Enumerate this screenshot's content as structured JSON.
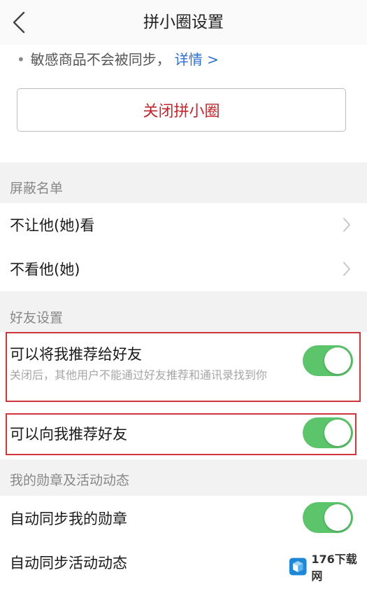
{
  "nav": {
    "title": "拼小圈设置",
    "back_icon": "chevron-left-icon"
  },
  "notice": {
    "bullet": "•",
    "text": "敏感商品不会被同步，",
    "link": "详情 >"
  },
  "close_button": {
    "label": "关闭拼小圈"
  },
  "sections": {
    "block_list": {
      "header": "屏蔽名单",
      "items": [
        {
          "label": "不让他(她)看"
        },
        {
          "label": "不看他(她)"
        }
      ]
    },
    "friend_settings": {
      "header": "好友设置",
      "recommend_me": {
        "label": "可以将我推荐给好友",
        "description": "关闭后，其他用户不能通过好友推荐和通讯录找到你",
        "enabled": true
      },
      "recommend_to_me": {
        "label": "可以向我推荐好友",
        "enabled": true
      }
    },
    "badges": {
      "header": "我的勋章及活动动态",
      "sync_badges": {
        "label": "自动同步我的勋章",
        "enabled": true
      },
      "sync_activity": {
        "label": "自动同步活动动态"
      }
    }
  },
  "watermark": {
    "text": "176下载网"
  },
  "colors": {
    "toggle_on": "#5cc46b",
    "link": "#2d6fd1",
    "danger": "#c0262d",
    "highlight": "#d0353b"
  }
}
